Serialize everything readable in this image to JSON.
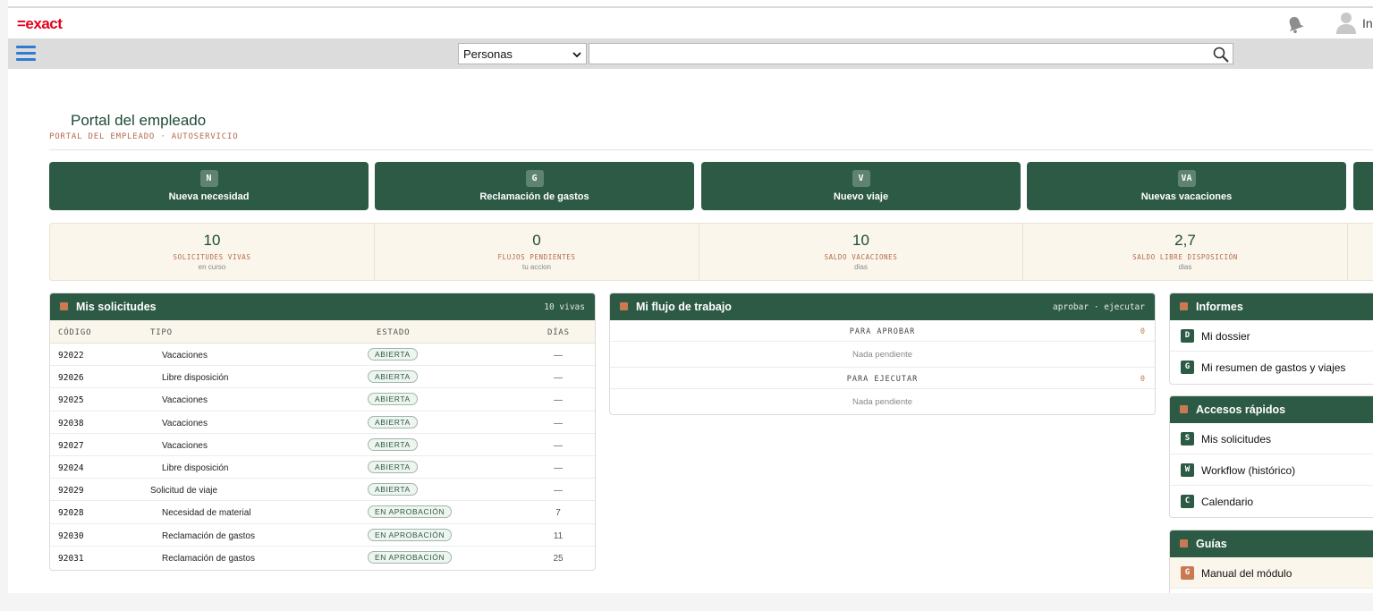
{
  "app": {
    "logo": "=exact",
    "user_initial": "In"
  },
  "search": {
    "scope": "Personas",
    "placeholder": ""
  },
  "page": {
    "title": "Portal del empleado",
    "subtitle": "PORTAL DEL EMPLEADO · AUTOSERVICIO"
  },
  "actions": [
    {
      "badge": "N",
      "label": "Nueva necesidad"
    },
    {
      "badge": "G",
      "label": "Reclamación de gastos"
    },
    {
      "badge": "V",
      "label": "Nuevo viaje"
    },
    {
      "badge": "VA",
      "label": "Nuevas vacaciones"
    }
  ],
  "stats": [
    {
      "value": "10",
      "caption": "SOLICITUDES VIVAS",
      "sub": "en curso"
    },
    {
      "value": "0",
      "caption": "FLUJOS PENDIENTES",
      "sub": "tu accion"
    },
    {
      "value": "10",
      "caption": "SALDO VACACIONES",
      "sub": "dias"
    },
    {
      "value": "2,7",
      "caption": "SALDO LIBRE DISPOSICIÓN",
      "sub": "dias"
    }
  ],
  "requests": {
    "title": "Mis solicitudes",
    "count_label": "10 vivas",
    "columns": [
      "CÓDIGO",
      "TIPO",
      "ESTADO",
      "DÍAS"
    ],
    "rows": [
      {
        "code": "92022",
        "type": "Vacaciones",
        "status": "ABIERTA",
        "days": "—",
        "indent": true
      },
      {
        "code": "92026",
        "type": "Libre disposición",
        "status": "ABIERTA",
        "days": "—",
        "indent": true
      },
      {
        "code": "92025",
        "type": "Vacaciones",
        "status": "ABIERTA",
        "days": "—",
        "indent": true
      },
      {
        "code": "92038",
        "type": "Vacaciones",
        "status": "ABIERTA",
        "days": "—",
        "indent": true
      },
      {
        "code": "92027",
        "type": "Vacaciones",
        "status": "ABIERTA",
        "days": "—",
        "indent": true
      },
      {
        "code": "92024",
        "type": "Libre disposición",
        "status": "ABIERTA",
        "days": "—",
        "indent": true
      },
      {
        "code": "92029",
        "type": "Solicitud de viaje",
        "status": "ABIERTA",
        "days": "—",
        "indent": false
      },
      {
        "code": "92028",
        "type": "Necesidad de material",
        "status": "EN APROBACIÓN",
        "days": "7",
        "indent": true
      },
      {
        "code": "92030",
        "type": "Reclamación de gastos",
        "status": "EN APROBACIÓN",
        "days": "11",
        "indent": true
      },
      {
        "code": "92031",
        "type": "Reclamación de gastos",
        "status": "EN APROBACIÓN",
        "days": "25",
        "indent": true
      }
    ]
  },
  "workflow": {
    "title": "Mi flujo de trabajo",
    "right_label": "aprobar · ejecutar",
    "sections": [
      {
        "label": "PARA APROBAR",
        "count": "0",
        "empty": "Nada pendiente"
      },
      {
        "label": "PARA EJECUTAR",
        "count": "0",
        "empty": "Nada pendiente"
      }
    ]
  },
  "reports": {
    "title": "Informes",
    "items": [
      {
        "key": "D",
        "label": "Mi dossier"
      },
      {
        "key": "G",
        "label": "Mi resumen de gastos y viajes"
      }
    ]
  },
  "quick_access": {
    "title": "Accesos rápidos",
    "items": [
      {
        "key": "S",
        "label": "Mis solicitudes"
      },
      {
        "key": "W",
        "label": "Workflow (histórico)"
      },
      {
        "key": "C",
        "label": "Calendario"
      }
    ]
  },
  "guides": {
    "title": "Guías",
    "items": [
      {
        "key": "G",
        "label": "Manual del módulo"
      }
    ]
  },
  "colors": {
    "brand_green": "#2d5a45",
    "accent_orange": "#c97a52",
    "logo_red": "#e3001b"
  }
}
